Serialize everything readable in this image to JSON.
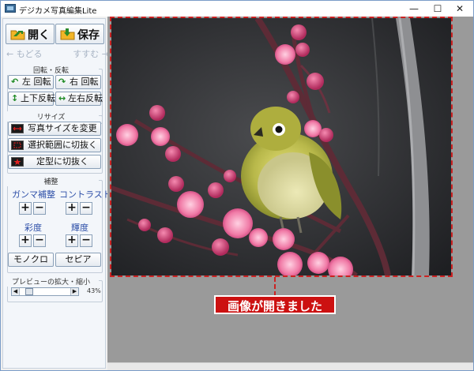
{
  "window": {
    "title": "デジカメ写真編集Lite",
    "controls": {
      "minimize": "—",
      "maximize": "☐",
      "close": "✕"
    }
  },
  "toolbar": {
    "open_label": "開く",
    "save_label": "保存",
    "back_label": "← もどる",
    "forward_label": "すすむ →"
  },
  "rotate_group": {
    "title": "回転・反転",
    "rotate_left": "左 回転",
    "rotate_right": "右 回転",
    "flip_vertical": "上下反転",
    "flip_horizontal": "左右反転"
  },
  "resize_group": {
    "title": "リサイズ",
    "resize_photo": "写真サイズを変更",
    "crop_selection": "選択範囲に切抜く",
    "crop_fixed": "定型に切抜く"
  },
  "adjust_group": {
    "title": "補整",
    "gamma": "ガンマ補整",
    "contrast": "コントラスト",
    "saturation": "彩度",
    "brightness": "輝度",
    "plus": "+",
    "minus": "−",
    "mono": "モノクロ",
    "sepia": "セピア"
  },
  "preview_group": {
    "title": "プレビューの拡大・縮小",
    "zoom_value": "43%",
    "zoom_fraction": 0.15
  },
  "status": {
    "message": "画像が開きました"
  },
  "colors": {
    "accent": "#cc1111",
    "selection": "#cc2222",
    "label_blue": "#2d4fa8"
  }
}
